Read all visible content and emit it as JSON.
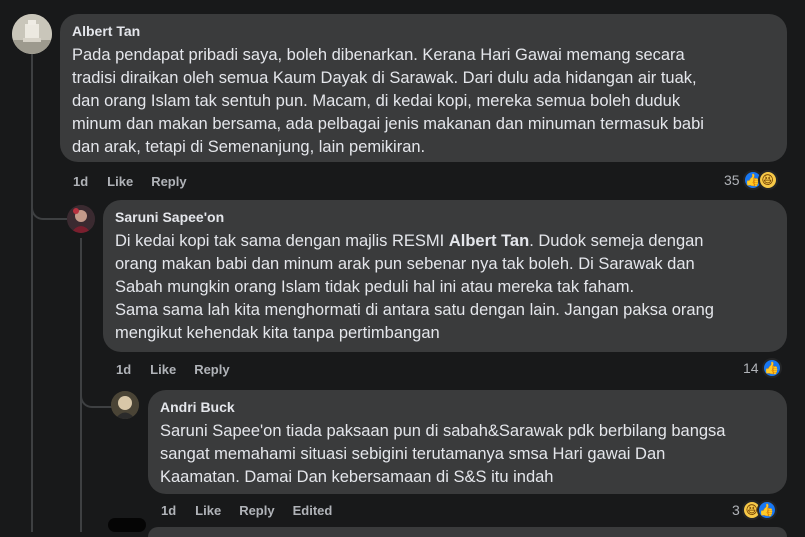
{
  "comments": [
    {
      "author": "Albert Tan",
      "lines": [
        "Pada pendapat pribadi saya, boleh dibenarkan. Kerana Hari Gawai memang secara",
        "tradisi diraikan oleh semua Kaum Dayak di Sarawak. Dari dulu ada hidangan air tuak,",
        "dan orang Islam tak sentuh pun. Macam, di kedai kopi, mereka semua boleh duduk",
        "minum dan makan bersama, ada pelbagai jenis makanan dan minuman termasuk babi",
        "dan arak, tetapi di Semenanjung, lain pemikiran."
      ],
      "time": "1d",
      "like_label": "Like",
      "reply_label": "Reply",
      "reaction_count": "35"
    },
    {
      "author": "Saruni Sapee'on",
      "line1_before": "Di kedai kopi tak sama dengan majlis RESMI ",
      "line1_mention": "Albert Tan",
      "line1_after": ". Dudok semeja dengan",
      "lines": [
        "orang makan babi dan minum arak pun sebenar nya tak boleh. Di Sarawak dan",
        "Sabah mungkin orang Islam tidak peduli hal ini atau mereka tak faham.",
        "Sama sama lah kita menghormati di antara satu dengan lain. Jangan paksa orang",
        "mengikut kehendak kita tanpa pertimbangan"
      ],
      "time": "1d",
      "like_label": "Like",
      "reply_label": "Reply",
      "reaction_count": "14"
    },
    {
      "author": "Andri Buck",
      "lines": [
        "Saruni Sapee'on tiada paksaan pun di sabah&Sarawak pdk berbilang bangsa",
        "sangat memahami situasi sebigini terutamanya smsa Hari gawai Dan",
        "Kaamatan. Damai Dan kebersamaan di S&S itu indah"
      ],
      "time": "1d",
      "like_label": "Like",
      "reply_label": "Reply",
      "edited_label": "Edited",
      "reaction_count": "3"
    }
  ],
  "colors": {
    "background": "#18191a",
    "bubble": "#3a3b3c",
    "like_blue": "#1877f2",
    "haha_yellow": "#f7c948"
  },
  "icons": [
    "like-reaction-icon",
    "haha-reaction-icon"
  ]
}
